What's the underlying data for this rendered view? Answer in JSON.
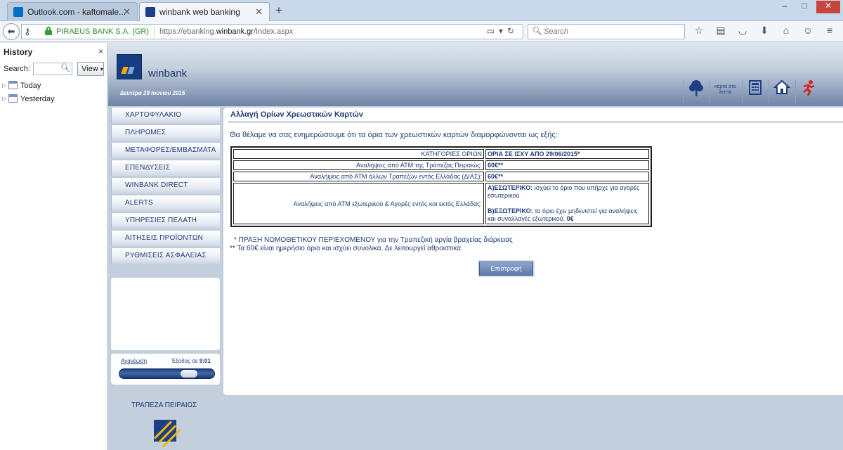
{
  "browser": {
    "tabs": [
      {
        "title": "Outlook.com - kaftomale...",
        "active": false,
        "favicon_color": "#0072c6"
      },
      {
        "title": "winbank web banking",
        "active": true,
        "favicon_color": "#1d3f86"
      }
    ],
    "new_tab_glyph": "+",
    "window_controls": [
      "–",
      "□",
      "✕"
    ],
    "identity": "PIRAEUS BANK S.A. (GR)",
    "url_prefix": "https://ebanking.",
    "url_domain": "winbank.gr",
    "url_path": "/Index.aspx",
    "search_placeholder": "Search",
    "toolbar_icons": [
      "star-icon",
      "reading-list-icon",
      "pocket-icon",
      "download-icon",
      "home-icon",
      "chat-icon",
      "menu-icon"
    ]
  },
  "history_sidebar": {
    "title": "History",
    "close_glyph": "×",
    "search_label": "Search:",
    "view_button": "View",
    "groups": [
      "Today",
      "Yesterday"
    ]
  },
  "bank": {
    "brand": "winbank",
    "date": "Δευτέρα 29 Ιουνίου 2015",
    "header_icons": [
      "tree-icon",
      "instant-card-icon",
      "calculator-icon",
      "home-icon",
      "exit-runner-icon"
    ],
    "instant_card_label": "κάρτα στο λεπτό",
    "menu": [
      "ΧΑΡΤΟΦΥΛΑΚΙΟ",
      "ΠΛΗΡΩΜΕΣ",
      "ΜΕΤΑΦΟΡΕΣ/ΕΜΒΑΣΜΑΤΑ",
      "ΕΠΕΝΔΥΣΕΙΣ",
      "WINBANK DIRECT",
      "ALERTS",
      "ΥΠΗΡΕΣΙΕΣ ΠΕΛΑΤΗ",
      "ΑΙΤΗΣΕΙΣ ΠΡΟΪΟΝΤΩΝ",
      "ΡΥΘΜΙΣΕΙΣ ΑΣΦΑΛΕΙΑΣ"
    ],
    "session": {
      "refresh_label": "Ανανέωση",
      "exit_label": "Έξοδος σε",
      "time": "9:01",
      "remaining_fraction": 0.8
    },
    "footer_name": "ΤΡΑΠΕΖΑ ΠΕΙΡΑΙΩΣ"
  },
  "content": {
    "title": "Αλλαγή Ορίων Χρεωστικών Καρτών",
    "intro": "Θα θέλαμε να σας ενημερώσουμε ότι τα όρια των χρεωστικών καρτών διαμορφώνονται ως εξής:",
    "table": {
      "header_left": "ΚΑΤΗΓΟΡΙΕΣ ΟΡΙΩΝ",
      "header_right": "ΟΡΙΑ ΣΕ ΙΣΧΥ ΑΠΟ 29/06/2015*",
      "rows": [
        {
          "category": "Αναλήψεις από ΑΤΜ της Τράπεζας Πειραιώς:",
          "value": "60€**"
        },
        {
          "category": "Αναλήψεις από ΑΤΜ άλλων Τραπεζών εντός Ελλάδας (ΔΙΑΣ):",
          "value": "60€**"
        }
      ],
      "last_row": {
        "category": "Αναλήψεις από ΑΤΜ εξωτερικού & Αγορές εντός και εκτός Ελλάδας:",
        "domestic_label": "Α)ΕΣΩΤΕΡΙΚΟ:",
        "domestic_text": "ισχύει το όριο που υπήρχε για αγορές εσωτερικού",
        "foreign_label": "Β)ΕΞΩΤΕΡΙΚΟ:",
        "foreign_text": "το όριο έχει μηδενιστεί για αναλήψεις και συναλλαγές εξωτερικού.",
        "foreign_value": "0€"
      }
    },
    "note1": "* ΠΡΑΞΗ ΝΟΜΟΘΕΤΙΚΟΥ ΠΕΡΙΕΧΟΜΕΝΟΥ για την Τραπεζική αργία βραχείας διάρκειας",
    "note2": "** Τα 60€ είναι ημερήσιο όριο και ισχύει συνολικά. Δε λειτουργεί αθροιστικά.",
    "back_button": "Επιστροφή"
  }
}
